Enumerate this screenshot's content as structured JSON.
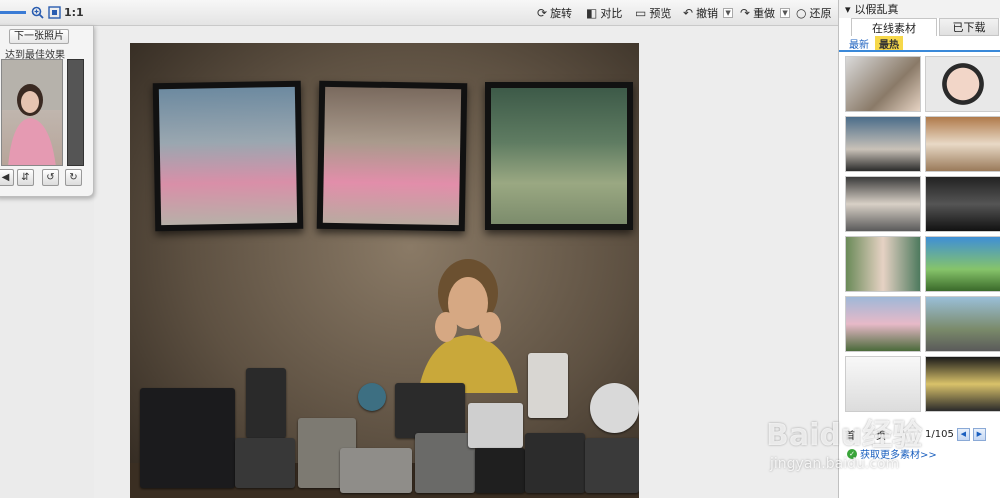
{
  "toolbar": {
    "zoom_label": "1:1",
    "buttons": {
      "rotate": "旋转",
      "compare": "对比",
      "preview": "预览",
      "undo": "撤销",
      "redo": "重做",
      "restore": "还原"
    },
    "icons": [
      "zoom-in-icon",
      "fit-to-window-icon",
      "rotate-icon",
      "compare-icon",
      "preview-icon",
      "undo-icon",
      "redo-icon",
      "restore-icon"
    ]
  },
  "left_panel": {
    "next_photo_label": "下一张照片",
    "best_effect_label": "达到最佳效果"
  },
  "right_panel": {
    "header_title": "以假乱真",
    "tabs": {
      "online": "在线素材",
      "downloaded": "已下载"
    },
    "subtabs": {
      "newest": "最新",
      "hottest": "最热"
    },
    "pager": {
      "first_char": "首",
      "page_char": "页",
      "page_info": "1/105"
    },
    "more_link": "获取更多素材>>"
  },
  "watermark": {
    "logo_text": "Baidu经验",
    "url": "jingyan.baidu.com"
  },
  "colors": {
    "accent": "#3a89d9",
    "hot_tab": "#f6d84a",
    "link": "#1a5fbf"
  }
}
